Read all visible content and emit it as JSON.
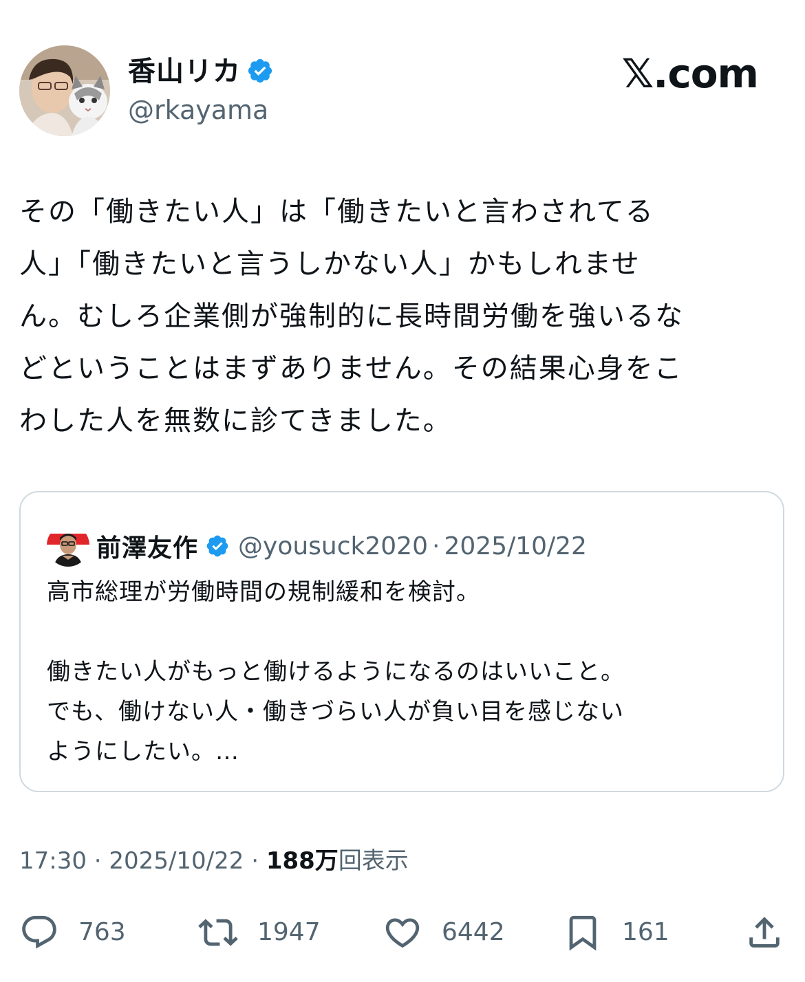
{
  "author": {
    "name": "香山リカ",
    "handle": "@rkayama",
    "avatar_icon": "profile-photo-with-cat",
    "verified_icon": "verified-badge-icon"
  },
  "brand": {
    "label": "𝕏.com"
  },
  "tweet": {
    "text": "その「働きたい人」は「働きたいと言わされてる\n人」「働きたいと言うしかない人」かもしれませ\nん。むしろ企業側が強制的に長時間労働を強いるな\nどということはまずありません。その結果心身をこ\nわした人を無数に診てきました。"
  },
  "quote": {
    "name": "前澤友作",
    "handle": "@yousuck2020",
    "separator": "·",
    "date": "2025/10/22",
    "text": "高市総理が労働時間の規制緩和を検討。\n\n働きたい人がもっと働けるようになるのはいいこと。\nでも、働けない人・働きづらい人が負い目を感じない\nようにしたい。…"
  },
  "meta": {
    "time": "17:30",
    "separator": "·",
    "date": "2025/10/22",
    "views_count": "188万",
    "views_label": "回表示"
  },
  "actions": {
    "replies": "763",
    "reposts": "1947",
    "likes": "6442",
    "bookmarks": "161"
  },
  "colors": {
    "text": "#0f1419",
    "secondary": "#536471",
    "verified": "#1d9bf0",
    "border": "#cfd9de"
  }
}
